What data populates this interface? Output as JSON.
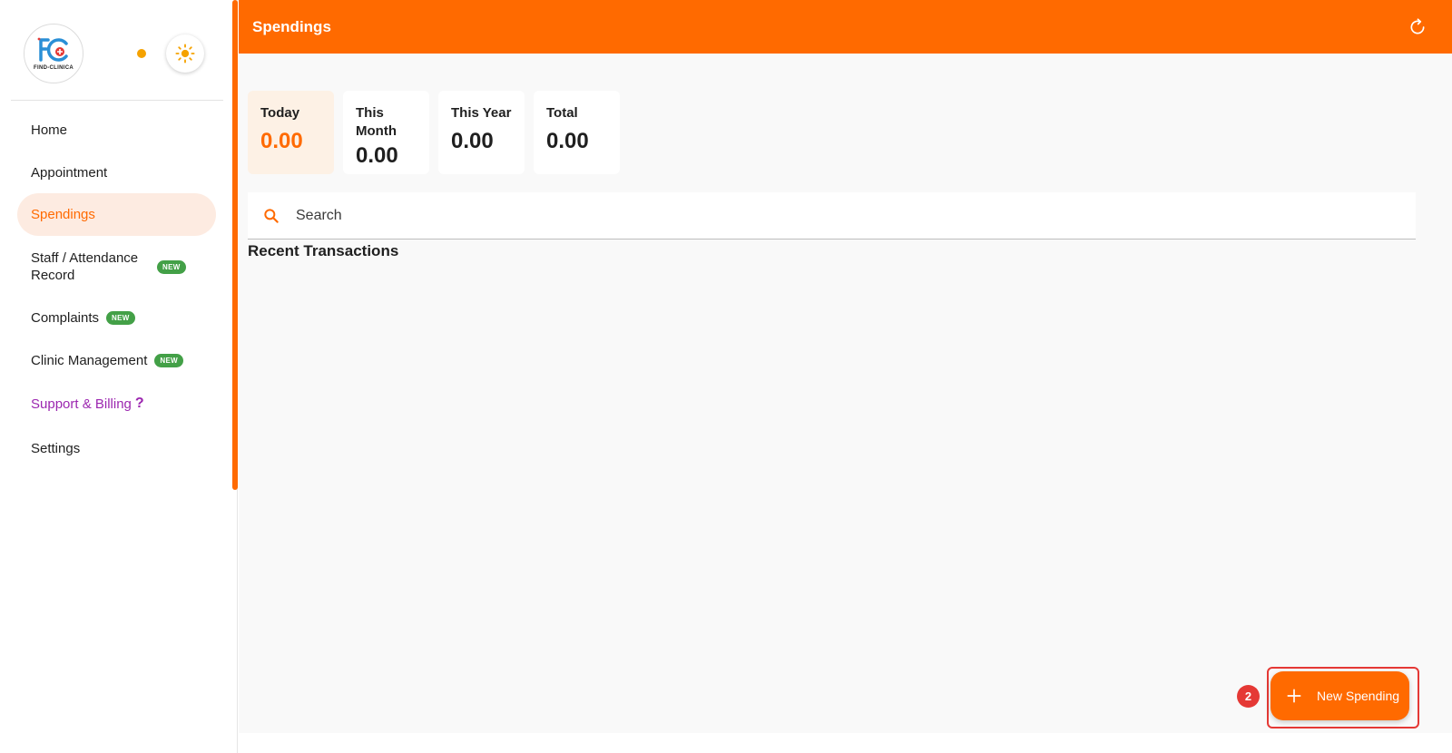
{
  "brand": {
    "logo_text": "FIND-CLINICA"
  },
  "header": {
    "title": "Spendings"
  },
  "sidebar": {
    "items": [
      {
        "label": "Home"
      },
      {
        "label": "Appointment"
      },
      {
        "label": "Spendings"
      },
      {
        "label": "Staff / Attendance Record",
        "badge": "NEW"
      },
      {
        "label": "Complaints",
        "badge": "NEW"
      },
      {
        "label": "Clinic Management",
        "badge": "NEW"
      },
      {
        "label": "Support & Billing",
        "suffix": "?"
      },
      {
        "label": "Settings"
      }
    ]
  },
  "summary": {
    "cards": [
      {
        "label": "Today",
        "value": "0.00"
      },
      {
        "label": "This Month",
        "value": "0.00"
      },
      {
        "label": "This Year",
        "value": "0.00"
      },
      {
        "label": "Total",
        "value": "0.00"
      }
    ]
  },
  "search": {
    "placeholder": "Search"
  },
  "transactions": {
    "title": "Recent Transactions"
  },
  "fab": {
    "label": "New Spending",
    "step": "2"
  },
  "colors": {
    "accent": "#ff6a00",
    "active_bg": "#fdebe1",
    "new_badge": "#43a047",
    "support": "#9c27b0",
    "highlight": "#e53935"
  }
}
